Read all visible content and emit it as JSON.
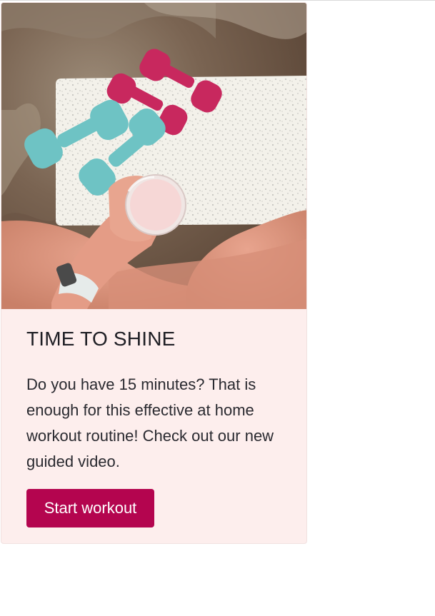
{
  "card": {
    "image_alt": "Hand holding a pink smoothie above a speckled yoga mat with teal and pink dumbbells",
    "title": "TIME TO SHINE",
    "text": "Do you have 15 minutes? That is enough for this effective at home workout routine! Check out our new guided video.",
    "button_label": "Start workout"
  },
  "colors": {
    "card_background": "#fdeeed",
    "button": "#b4054f",
    "dumbbell_pink": "#c8285e",
    "dumbbell_teal": "#6ec3c4"
  }
}
